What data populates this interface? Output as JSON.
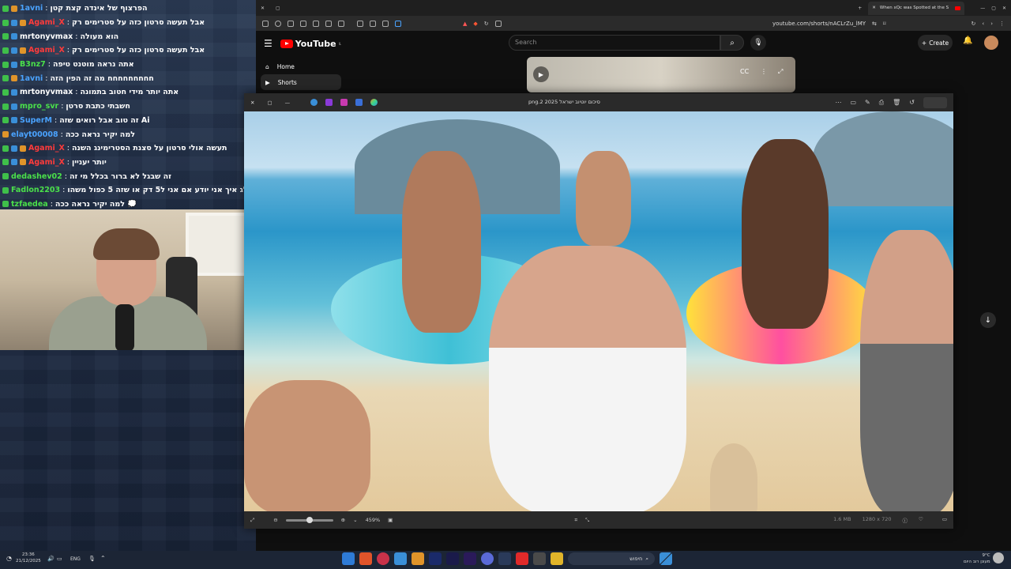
{
  "chat": [
    {
      "user": "1avni",
      "user_color": "#4aa3ff",
      "message": "הפרצוף של אינדה קצת קטן",
      "badges": [
        "green",
        "orange"
      ]
    },
    {
      "user": "Agami_X",
      "user_color": "#ff3b3b",
      "message": "אבל תעשה סרטון כזה על סטרימים רק",
      "badges": [
        "green",
        "blue",
        "orange"
      ]
    },
    {
      "user": "mrtonyvmax",
      "user_color": "#ffffff",
      "message": "הוא מעולה",
      "badges": [
        "green",
        "blue"
      ]
    },
    {
      "user": "Agami_X",
      "user_color": "#ff3b3b",
      "message": "אבל תעשה סרטון כזה על סטרימים רק",
      "badges": [
        "green",
        "blue",
        "orange"
      ]
    },
    {
      "user": "B3nz7",
      "user_color": "#4ae04a",
      "message": "אתה נראה מוטנט טיפה",
      "badges": [
        "green",
        "blue"
      ]
    },
    {
      "user": "1avni",
      "user_color": "#4aa3ff",
      "message": "חחחחחחחחח מה זה הפין הזה",
      "badges": [
        "green",
        "orange"
      ]
    },
    {
      "user": "mrtonyvmax",
      "user_color": "#ffffff",
      "message": "אתה יותר מידי חטוב בתמונה",
      "badges": [
        "green",
        "blue"
      ]
    },
    {
      "user": "mpro_svr",
      "user_color": "#4ae04a",
      "message": "חשבתי כתבת סרטן",
      "badges": [
        "green",
        "blue"
      ]
    },
    {
      "user": "SuperM",
      "user_color": "#4aa3ff",
      "message": "זה טוב אבל רואים שזה Ai",
      "badges": [
        "green",
        "blue"
      ]
    },
    {
      "user": "elayt00008",
      "user_color": "#4aa3ff",
      "message": "למה יקיר נראה ככה",
      "badges": [
        "orange"
      ]
    },
    {
      "user": "Agami_X",
      "user_color": "#ff3b3b",
      "message": "תעשה אולי סרטון על סצנת הסטרימינג השנה",
      "badges": [
        "green",
        "blue",
        "orange"
      ]
    },
    {
      "user": "Agami_X",
      "user_color": "#ff3b3b",
      "message": "יותר יעניין",
      "badges": [
        "green",
        "blue",
        "orange"
      ]
    },
    {
      "user": "dedashev02",
      "user_color": "#4ae04a",
      "message": "זה שבגל לא ברור בכלל מי זה",
      "badges": [
        "green"
      ]
    },
    {
      "user": "Fadlon2203",
      "user_color": "#4ae04a",
      "message": "שו אם אני בגולג איך אני יודע אם אני ל5 דק או שזה 5 כפול משהו",
      "badges": [
        "green"
      ]
    },
    {
      "user": "tzfaedea",
      "user_color": "#4ae04a",
      "message": "למה יקיר נראה ככה 💭",
      "badges": [
        "green"
      ]
    }
  ],
  "browser": {
    "tab_title": "When xQc was Spotted at the S",
    "url": "youtube.com/shorts/nACLrZu_lMY"
  },
  "youtube": {
    "logo_text": "YouTube",
    "logo_region": "IL",
    "search_placeholder": "Search",
    "create_label": "Create",
    "nav": [
      {
        "label": "Home",
        "icon": "home-icon"
      },
      {
        "label": "Shorts",
        "icon": "shorts-icon"
      }
    ]
  },
  "viewer": {
    "title": "סיכום יוטיוב ישראל 2025 png.2",
    "zoom": "459%",
    "file_size": "1.6 MB",
    "dimensions": "1280 x 720"
  },
  "taskbar": {
    "time": "23:36",
    "date": "21/12/2025",
    "language": "ENG",
    "search_placeholder": "חיפוש",
    "weather_temp": "9°C",
    "weather_desc": "מעונן רוב היום"
  },
  "colors": {
    "youtube_red": "#ff0000",
    "taskbar_bg": "#1c2535",
    "chat_green_badge": "#3fbf4a"
  }
}
